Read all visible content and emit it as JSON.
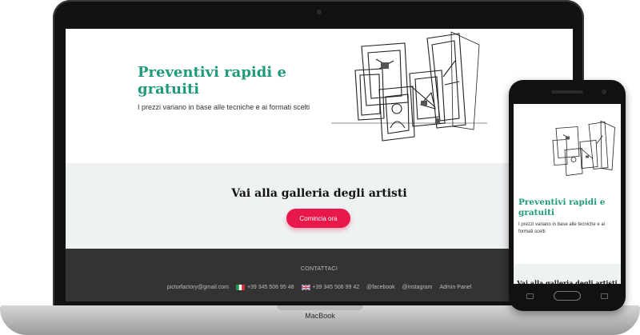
{
  "site": {
    "hero": {
      "title": "Preventivi rapidi e gratuiti",
      "subtitle": "I prezzi variano in base alle tecniche e ai formati scelti",
      "illustration": "stacked-picture-frames-sketch"
    },
    "gallery": {
      "title": "Vai alla galleria degli artisti",
      "cta_label": "Comincia ora"
    },
    "footer": {
      "heading": "CONTATTACI",
      "email": "pictorfactory@gmail.com",
      "phone_it": "+39 345 506 95 48",
      "phone_uk": "+39 345 506 99 42",
      "facebook": "@facebook",
      "instagram": "@instagram",
      "admin": "Admin Panel"
    }
  },
  "device": {
    "laptop_brand": "MacBook"
  },
  "colors": {
    "accent_green": "#1f9a7b",
    "cta_red": "#e8184a",
    "footer_bg": "#333333",
    "section_bg": "#eef2f3"
  }
}
